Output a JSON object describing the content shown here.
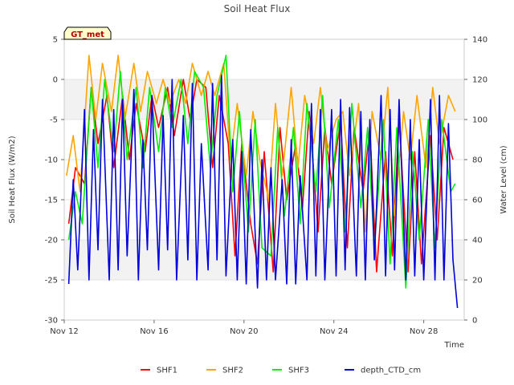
{
  "chart_data": {
    "type": "line",
    "title": "Soil Heat Flux",
    "xlabel": "Time",
    "ylabel_left": "Soil Heat Flux (W/m2)",
    "ylabel_right": "Water Level (cm)",
    "badge": "GT_met",
    "x_range": [
      0,
      17.8
    ],
    "y_left_range": [
      -30,
      5
    ],
    "y_right_range": [
      0,
      140
    ],
    "x_ticks": [
      {
        "x": 0,
        "label": "Nov 12"
      },
      {
        "x": 4,
        "label": "Nov 16"
      },
      {
        "x": 8,
        "label": "Nov 20"
      },
      {
        "x": 12,
        "label": "Nov 24"
      },
      {
        "x": 16,
        "label": "Nov 28"
      }
    ],
    "y_left_ticks": [
      5,
      0,
      -5,
      -10,
      -15,
      -20,
      -25,
      -30
    ],
    "y_right_ticks": [
      140,
      120,
      100,
      80,
      60,
      40,
      20,
      0
    ],
    "bands": [
      [
        -5,
        0
      ],
      [
        -25,
        -20
      ]
    ],
    "series": [
      {
        "name": "SHF1",
        "color": "#ff0000",
        "axis": "left",
        "x": [
          0.2,
          0.5,
          0.9,
          1.2,
          1.5,
          1.9,
          2.2,
          2.6,
          2.9,
          3.2,
          3.6,
          3.9,
          4.2,
          4.6,
          4.9,
          5.3,
          5.6,
          5.9,
          6.3,
          6.6,
          6.9,
          7.3,
          7.6,
          7.9,
          8.3,
          8.6,
          8.9,
          9.3,
          9.6,
          9.9,
          10.3,
          10.6,
          10.9,
          11.3,
          11.6,
          11.9,
          12.3,
          12.6,
          12.9,
          13.3,
          13.6,
          13.9,
          14.3,
          14.6,
          14.9,
          15.3,
          15.6,
          15.9,
          16.3,
          16.6,
          16.9,
          17.3
        ],
        "y": [
          -18,
          -11,
          -13,
          -1,
          -8,
          -2,
          -11,
          -2,
          -10,
          -3,
          -9,
          -2,
          -6,
          -1,
          -7,
          0,
          -5,
          0,
          -1,
          -11,
          -2,
          -8,
          -22,
          -8,
          -18,
          -23,
          -9,
          -24,
          -6,
          -15,
          -8,
          -16,
          -4,
          -19,
          -6,
          -13,
          -5,
          -21,
          -6,
          -14,
          -6,
          -24,
          -9,
          -22,
          -5,
          -24,
          -9,
          -23,
          -7,
          -20,
          -6,
          -10
        ]
      },
      {
        "name": "SHF2",
        "color": "#ffa500",
        "axis": "left",
        "x": [
          0.1,
          0.4,
          0.7,
          1.1,
          1.4,
          1.7,
          2.1,
          2.4,
          2.7,
          3.1,
          3.4,
          3.7,
          4.1,
          4.4,
          4.7,
          5.1,
          5.4,
          5.7,
          6.1,
          6.4,
          6.7,
          7.1,
          7.4,
          7.7,
          8.1,
          8.4,
          8.7,
          9.1,
          9.4,
          9.7,
          10.1,
          10.4,
          10.7,
          11.1,
          11.4,
          11.7,
          12.1,
          12.4,
          12.7,
          13.1,
          13.4,
          13.7,
          14.1,
          14.4,
          14.7,
          15.1,
          15.4,
          15.7,
          16.1,
          16.4,
          16.7,
          17.1,
          17.4
        ],
        "y": [
          -12,
          -7,
          -14,
          3,
          -5,
          2,
          -4,
          3,
          -5,
          2,
          -4,
          1,
          -3,
          0,
          -3,
          0,
          -3,
          2,
          -2,
          1,
          -2,
          2,
          -10,
          -3,
          -12,
          -4,
          -10,
          -15,
          -3,
          -12,
          -1,
          -11,
          -2,
          -8,
          -1,
          -9,
          -5,
          -4,
          -12,
          -3,
          -19,
          -4,
          -10,
          -1,
          -17,
          -4,
          -10,
          -2,
          -11,
          -1,
          -8,
          -2,
          -4
        ]
      },
      {
        "name": "SHF3",
        "color": "#00ee00",
        "axis": "left",
        "x": [
          0.2,
          0.5,
          0.8,
          1.2,
          1.5,
          1.8,
          2.2,
          2.5,
          2.8,
          3.2,
          3.5,
          3.8,
          4.2,
          4.5,
          4.8,
          5.2,
          5.5,
          5.8,
          6.2,
          6.5,
          6.8,
          7.2,
          7.5,
          7.8,
          8.2,
          8.5,
          8.8,
          9.2,
          9.5,
          9.8,
          10.2,
          10.5,
          10.8,
          11.2,
          11.5,
          11.8,
          12.2,
          12.5,
          12.8,
          13.2,
          13.5,
          13.8,
          14.2,
          14.5,
          14.8,
          15.2,
          15.5,
          15.8,
          16.2,
          16.5,
          16.8,
          17.2,
          17.4
        ],
        "y": [
          -20,
          -14,
          -18,
          -1,
          -11,
          0,
          -9,
          1,
          -10,
          -1,
          -11,
          -1,
          -9,
          -1,
          -6,
          0,
          -8,
          1,
          -1,
          -11,
          -2,
          3,
          -14,
          -4,
          -19,
          -5,
          -21,
          -22,
          -6,
          -17,
          -6,
          -18,
          -3,
          -14,
          -2,
          -16,
          -5,
          -19,
          -3,
          -16,
          -6,
          -21,
          -5,
          -23,
          -6,
          -26,
          -9,
          -20,
          -5,
          -21,
          -5,
          -14,
          -13
        ]
      },
      {
        "name": "depth_CTD_cm",
        "color": "#0000dd",
        "axis": "right",
        "x": [
          0.2,
          0.4,
          0.6,
          0.9,
          1.1,
          1.3,
          1.5,
          1.7,
          2.0,
          2.2,
          2.4,
          2.6,
          2.8,
          3.1,
          3.3,
          3.5,
          3.7,
          3.9,
          4.2,
          4.4,
          4.6,
          4.8,
          5.0,
          5.3,
          5.5,
          5.7,
          5.9,
          6.1,
          6.4,
          6.6,
          6.8,
          7.0,
          7.2,
          7.5,
          7.7,
          7.9,
          8.1,
          8.3,
          8.6,
          8.8,
          9.0,
          9.2,
          9.4,
          9.7,
          9.9,
          10.1,
          10.3,
          10.5,
          10.8,
          11.0,
          11.2,
          11.4,
          11.6,
          11.9,
          12.1,
          12.3,
          12.5,
          12.7,
          13.0,
          13.2,
          13.4,
          13.6,
          13.8,
          14.1,
          14.3,
          14.5,
          14.7,
          14.9,
          15.2,
          15.4,
          15.6,
          15.8,
          16.0,
          16.3,
          16.5,
          16.7,
          16.9,
          17.1,
          17.3,
          17.5
        ],
        "y": [
          18,
          70,
          25,
          105,
          20,
          95,
          35,
          110,
          20,
          105,
          25,
          110,
          32,
          115,
          20,
          90,
          35,
          112,
          25,
          102,
          35,
          120,
          20,
          102,
          30,
          118,
          20,
          88,
          25,
          118,
          30,
          122,
          22,
          90,
          20,
          84,
          18,
          95,
          16,
          80,
          20,
          76,
          20,
          70,
          18,
          90,
          18,
          72,
          20,
          108,
          22,
          105,
          20,
          105,
          22,
          110,
          25,
          106,
          22,
          104,
          20,
          100,
          30,
          112,
          22,
          105,
          25,
          110,
          20,
          100,
          22,
          90,
          20,
          110,
          20,
          112,
          20,
          98,
          30,
          6
        ]
      }
    ]
  }
}
